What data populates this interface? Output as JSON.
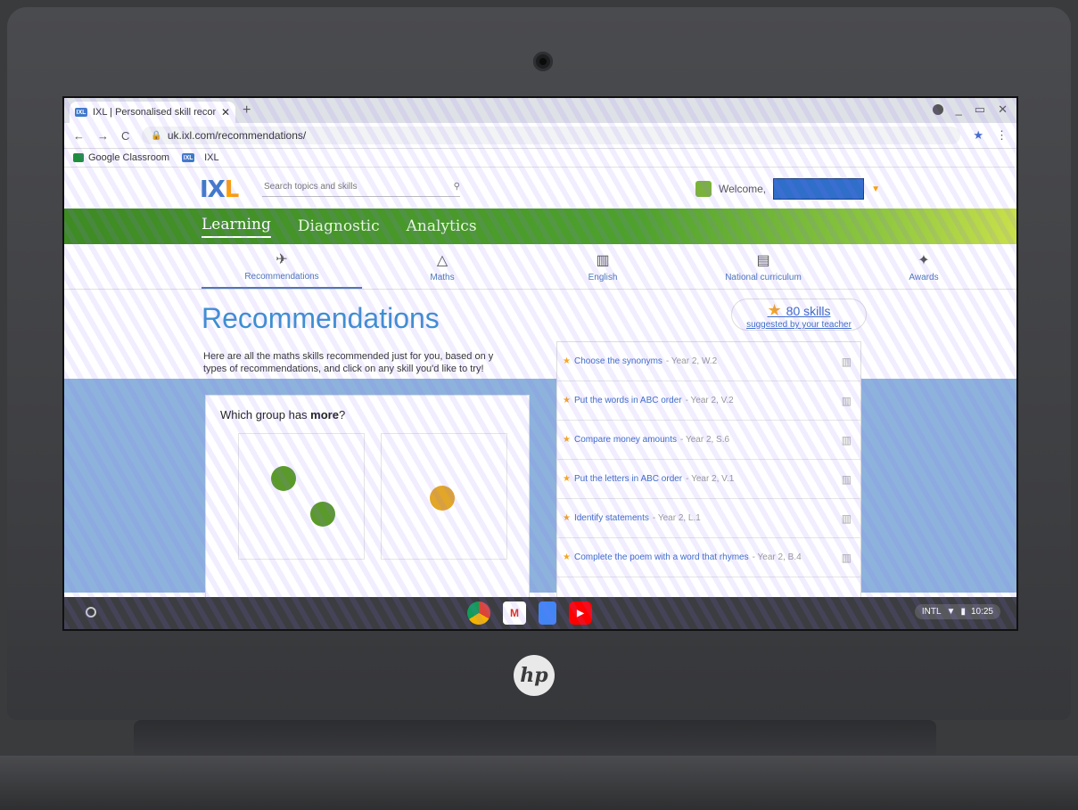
{
  "browser": {
    "tab_title": "IXL | Personalised skill recomme",
    "favicon_text": "IXL",
    "url": "uk.ixl.com/recommendations/",
    "bookmarks": [
      {
        "label": "Google Classroom"
      },
      {
        "label": "IXL"
      }
    ]
  },
  "ixl": {
    "logo_main": "IX",
    "logo_accent": "L",
    "search_placeholder": "Search topics and skills",
    "welcome": "Welcome,",
    "nav": [
      {
        "label": "Learning"
      },
      {
        "label": "Diagnostic"
      },
      {
        "label": "Analytics"
      }
    ],
    "subnav": [
      {
        "label": "Recommendations"
      },
      {
        "label": "Maths"
      },
      {
        "label": "English"
      },
      {
        "label": "National curriculum"
      },
      {
        "label": "Awards"
      }
    ]
  },
  "page": {
    "title": "Recommendations",
    "intro": "Here are all the maths skills recommended just for you, based on y\ntypes of recommendations, and click on any skill you'd like to try!",
    "skills_count": "80 skills",
    "skills_sub": "suggested by your teacher",
    "sample_question_pre": "Which group has ",
    "sample_question_bold": "more",
    "sample_question_post": "?"
  },
  "skills": [
    {
      "name": "Choose the synonyms",
      "level": "- Year 2, W.2"
    },
    {
      "name": "Put the words in ABC order",
      "level": "- Year 2, V.2"
    },
    {
      "name": "Compare money amounts",
      "level": "- Year 2, S.6"
    },
    {
      "name": "Put the letters in ABC order",
      "level": "- Year 2, V.1"
    },
    {
      "name": "Identify statements",
      "level": "- Year 2, L.1"
    },
    {
      "name": "Complete the poem with a word that rhymes",
      "level": "- Year 2, B.4"
    }
  ],
  "shelf": {
    "tray_text": "INTL",
    "time": "10:25"
  },
  "hp_logo_text": "hp",
  "colors": {
    "ixl_green": "#4ea12d",
    "ixl_blue": "#3d8fd1",
    "star": "#f5a623",
    "dot_green": "#5a9a2a",
    "dot_orange": "#e2a628"
  }
}
